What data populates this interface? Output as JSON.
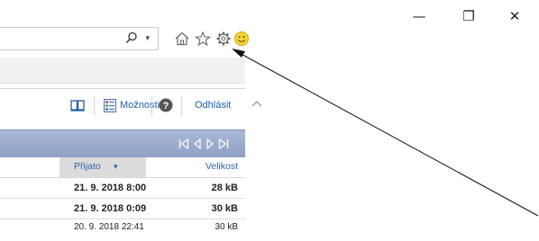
{
  "window": {
    "minimize": "—",
    "restore": "❐",
    "close": "✕"
  },
  "address_bar": {
    "search_icon": "search-icon",
    "dropdown": "▾"
  },
  "browser_toolbar": {
    "icons": [
      "home-icon",
      "favorites-star-icon",
      "settings-gear-icon",
      "smiley-feedback-icon"
    ]
  },
  "app_toolbar": {
    "book_icon": "address-book-icon",
    "options_label": "Možnosti",
    "help_icon": "help-icon",
    "logout_label": "Odhlásit"
  },
  "pager": {
    "icons": [
      "first-page-icon",
      "prev-page-icon",
      "next-page-icon",
      "last-page-icon"
    ]
  },
  "columns": {
    "received": "Přijato",
    "sort_indicator": "▾",
    "size": "Velikost"
  },
  "rows": [
    {
      "date": "21. 9. 2018 8:00",
      "size": "28 kB",
      "unread": true
    },
    {
      "date": "21. 9. 2018 0:09",
      "size": "30 kB",
      "unread": true
    },
    {
      "date": "20. 9. 2018 22:41",
      "size": "30 kB",
      "unread": false
    }
  ],
  "colors": {
    "link": "#1f5ea8",
    "header_band": "#9aabd0",
    "sorted_column": "#dcdcdc"
  }
}
